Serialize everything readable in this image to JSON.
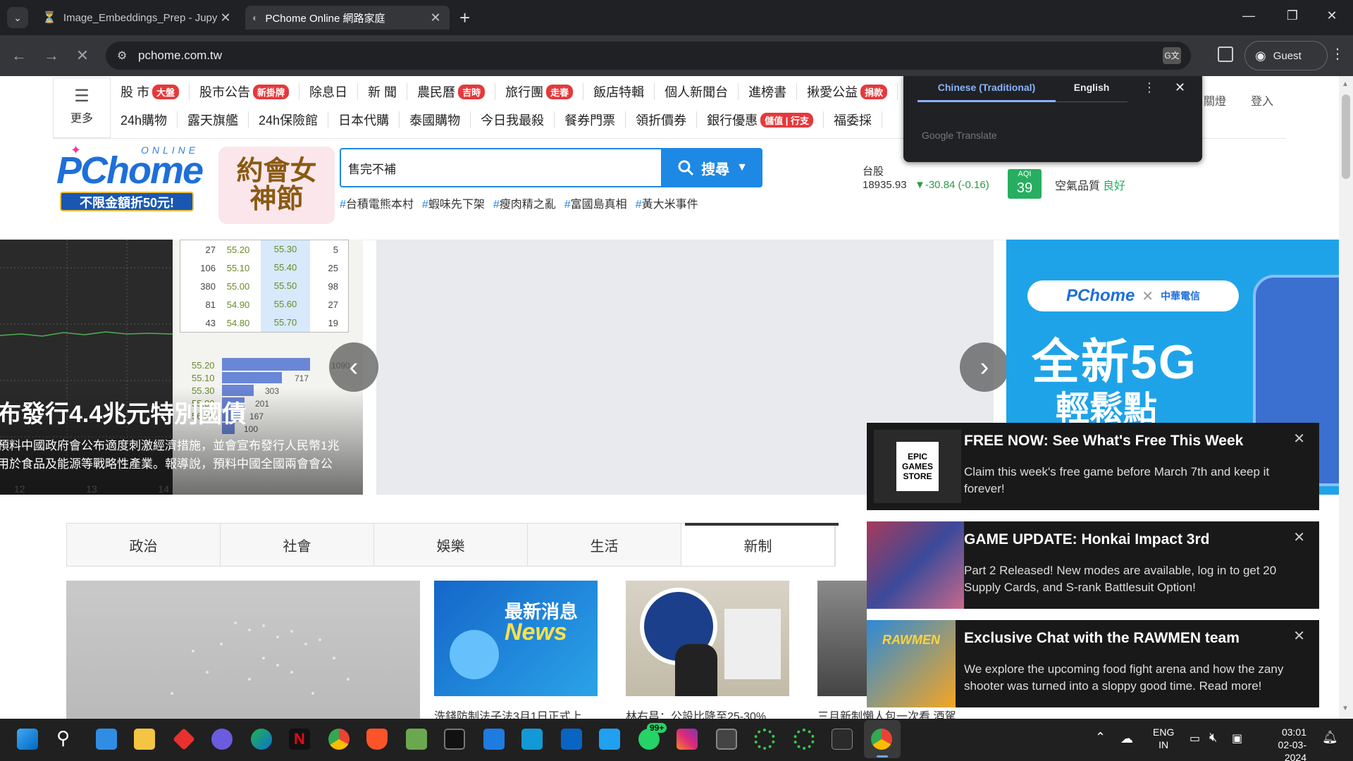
{
  "browser": {
    "tabs": [
      {
        "title": "Image_Embeddings_Prep - Jupy",
        "active": false
      },
      {
        "title": "PChome Online 網路家庭",
        "active": true
      }
    ],
    "url": "pchome.com.tw",
    "guest_label": "Guest"
  },
  "translate_popup": {
    "lang_source": "Chinese (Traditional)",
    "lang_target": "English",
    "footer": "Google Translate"
  },
  "site": {
    "menu_label": "更多",
    "nav_row1": [
      {
        "label": "股 市",
        "badge": "大盤"
      },
      {
        "label": "股市公告",
        "badge": "新掛牌"
      },
      {
        "label": "除息日",
        "badge": ""
      },
      {
        "label": "新 聞",
        "badge": ""
      },
      {
        "label": "農民曆",
        "badge": "吉時"
      },
      {
        "label": "旅行團",
        "badge": "走春"
      },
      {
        "label": "飯店特輯",
        "badge": ""
      },
      {
        "label": "個人新聞台",
        "badge": ""
      },
      {
        "label": "進榜書",
        "badge": ""
      },
      {
        "label": "揪愛公益",
        "badge": "捐款"
      }
    ],
    "nav_row2": [
      {
        "label": "24h購物",
        "badge": ""
      },
      {
        "label": "露天旗艦",
        "badge": ""
      },
      {
        "label": "24h保險館",
        "badge": ""
      },
      {
        "label": "日本代購",
        "badge": ""
      },
      {
        "label": "泰國購物",
        "badge": ""
      },
      {
        "label": "今日我最殺",
        "badge": ""
      },
      {
        "label": "餐券門票",
        "badge": ""
      },
      {
        "label": "領折價券",
        "badge": ""
      },
      {
        "label": "銀行優惠",
        "badge": "儲值 | 行支"
      },
      {
        "label": "福委採",
        "badge": ""
      }
    ],
    "top_right": {
      "light": "關燈",
      "login": "登入"
    },
    "logo": {
      "brand": "PChome",
      "online": "ONLINE",
      "promo": "不限金額折50元!",
      "event": "約會女神節"
    },
    "search": {
      "value": "售完不補",
      "button": "搜尋"
    },
    "hashtags": [
      "台積電熊本村",
      "蝦味先下架",
      "瘦肉精之亂",
      "富國島真相",
      "黃大米事件"
    ],
    "stock": {
      "label": "台股",
      "value": "18935.93",
      "change": "▼-30.84 (-0.16)"
    },
    "aqi": {
      "label": "AQI",
      "value": "39",
      "text": "空氣品質",
      "status": "良好"
    }
  },
  "carousel": {
    "headline": "布發行4.4兆元特別國債",
    "caption1": "預料中國政府會公布適度刺激經濟措施，並會宣布發行人民幣1兆",
    "caption2": "用於食品及能源等戰略性產業。報導說，預料中國全國兩會會公",
    "order_book": [
      [
        "27",
        "55.20",
        "55.30",
        "5"
      ],
      [
        "106",
        "55.10",
        "55.40",
        "25"
      ],
      [
        "380",
        "55.00",
        "55.50",
        "98"
      ],
      [
        "81",
        "54.90",
        "55.60",
        "27"
      ],
      [
        "43",
        "54.80",
        "55.70",
        "19"
      ]
    ],
    "vol_labels": [
      "55.20",
      "55.10",
      "55.30",
      "55.80",
      "56.00"
    ],
    "vol_values": [
      "1090",
      "717",
      "303",
      "201",
      "167",
      "100"
    ],
    "x_ticks": [
      "12",
      "13",
      "14"
    ]
  },
  "ad": {
    "brand": "PChome",
    "partner": "中華電信",
    "headline": "全新5G",
    "sub": "輕鬆點"
  },
  "news_tabs": [
    "政治",
    "社會",
    "娛樂",
    "生活",
    "新制"
  ],
  "news_cards": [
    {
      "img_title": "最新消息",
      "img_sub": "News",
      "caption": "洗錢防制法子法3月1日正式上"
    },
    {
      "img_title": "",
      "img_sub": "",
      "caption": "林右昌：公設比降至25-30%"
    },
    {
      "img_title": "",
      "img_sub": "",
      "caption": "三月新制懶人包一次看 酒駕"
    }
  ],
  "notifications": [
    {
      "title": "FREE NOW: See What's Free This Week",
      "body": "Claim this week's free game before March 7th and keep it forever!",
      "icon_text": "EPIC GAMES STORE"
    },
    {
      "title": "GAME UPDATE: Honkai Impact 3rd",
      "body": "Part 2 Released! New modes are available, log in to get 20 Supply Cards, and S-rank Battlesuit Option!",
      "icon_text": ""
    },
    {
      "title": "Exclusive Chat with the RAWMEN team",
      "body": "We explore the upcoming food fight arena and how the zany shooter was turned into a sloppy good time. Read more!",
      "icon_text": "RAWMEN"
    }
  ],
  "taskbar": {
    "lang": "ENG",
    "region": "IN",
    "time": "03:01",
    "date": "02-03-2024",
    "whatsapp_badge": "99+"
  }
}
